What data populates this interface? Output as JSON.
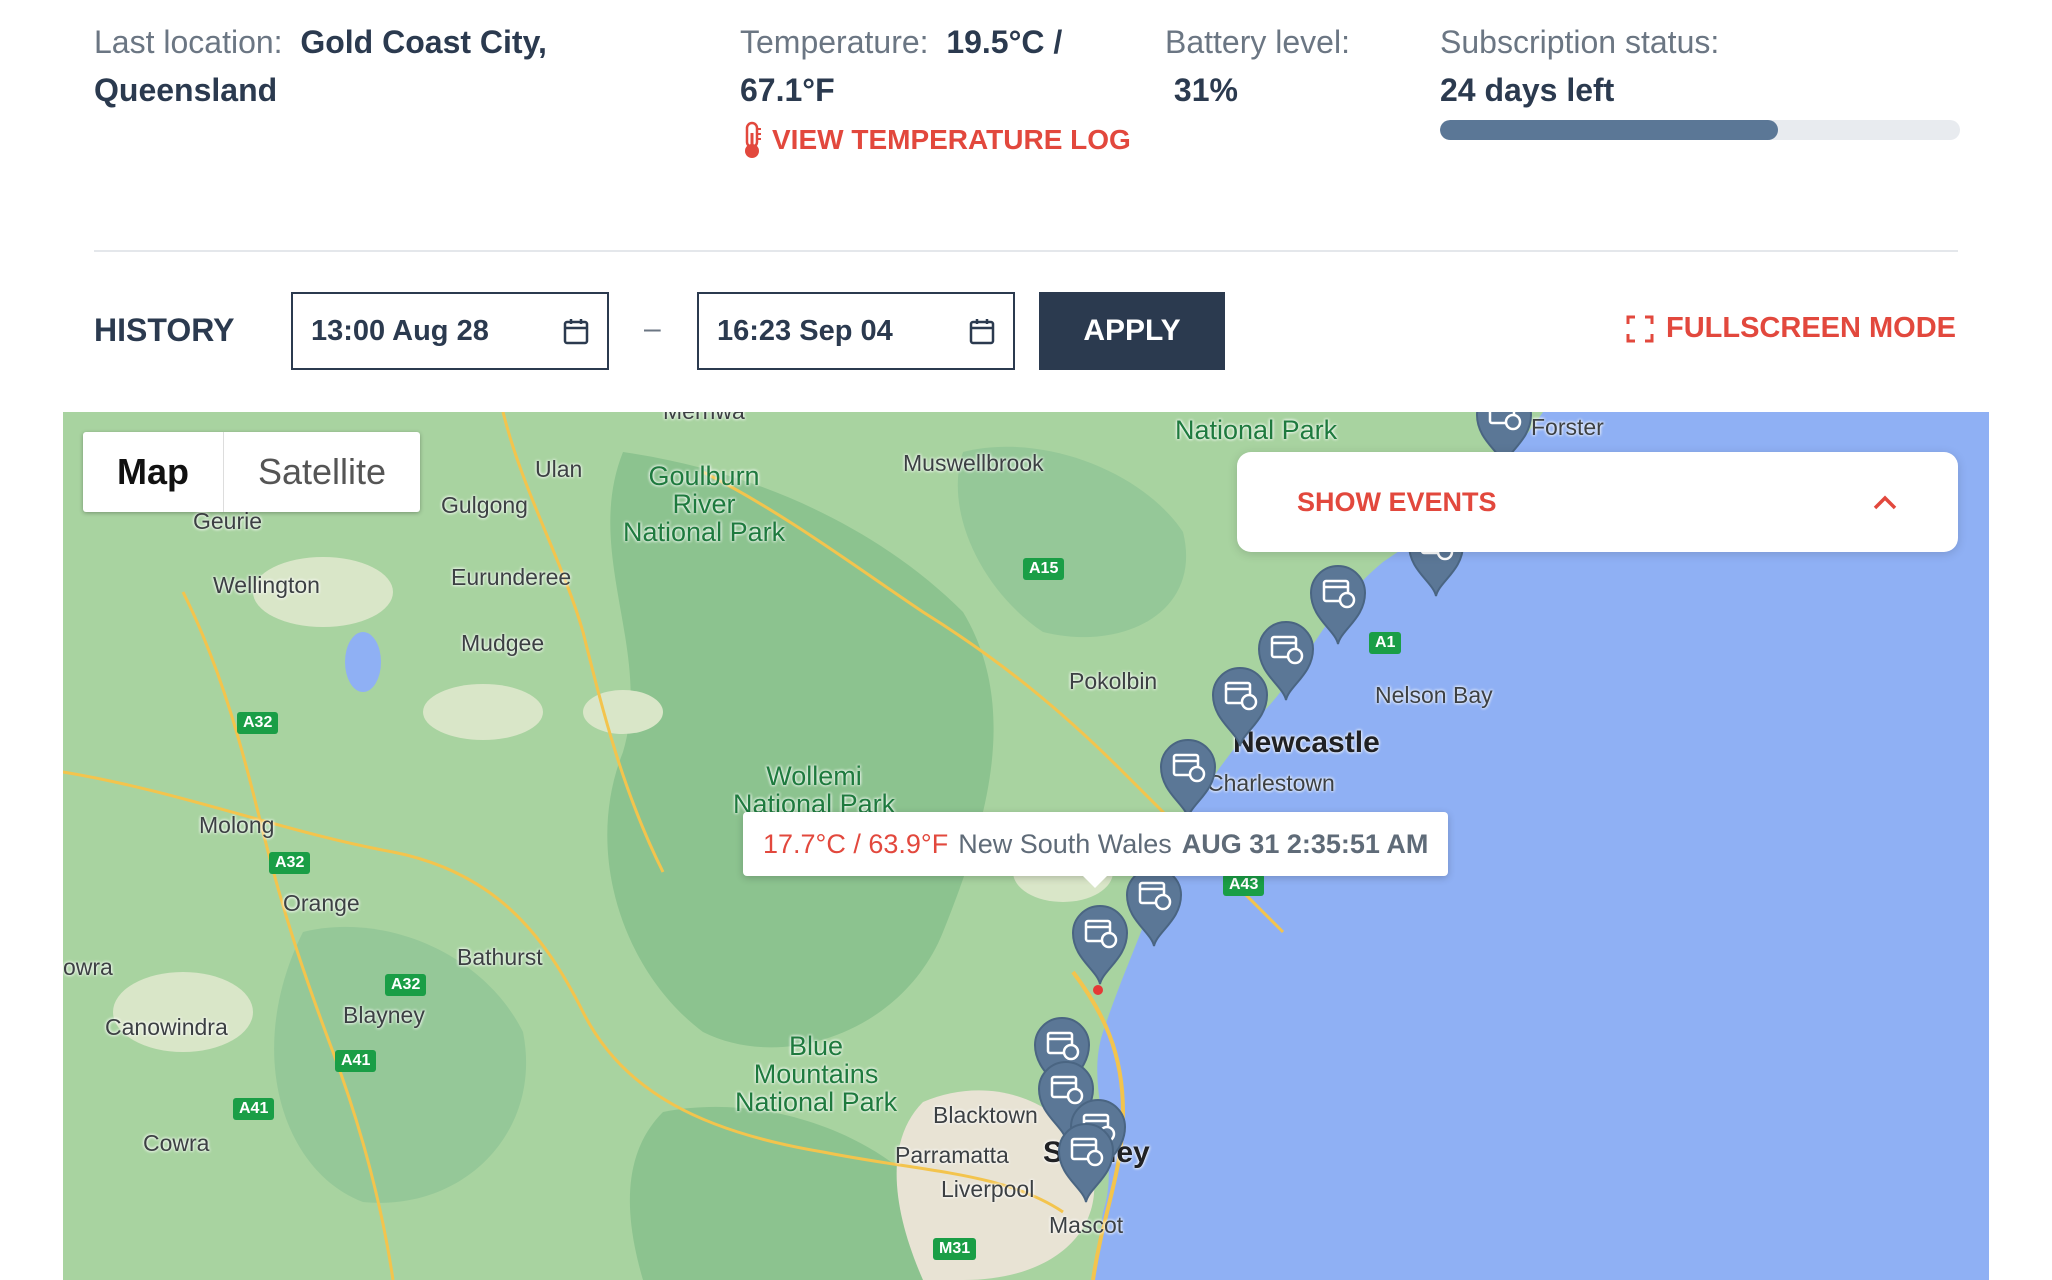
{
  "info": {
    "location_label": "Last location:",
    "location_value": "Gold Coast City, Queensland",
    "temperature_label": "Temperature:",
    "temperature_value": "19.5°C / 67.1°F",
    "temperature_log_link": "VIEW TEMPERATURE LOG",
    "battery_label": "Battery level:",
    "battery_value": "31%",
    "subscription_label": "Subscription status:",
    "subscription_value": "24 days left",
    "subscription_progress": 0.65
  },
  "history": {
    "title": "HISTORY",
    "start": "13:00 Aug 28",
    "separator": "–",
    "end": "16:23 Sep 04",
    "apply_label": "APPLY",
    "fullscreen_label": "FULLSCREEN MODE"
  },
  "map": {
    "type_map": "Map",
    "type_satellite": "Satellite",
    "show_events": "SHOW EVENTS",
    "tooltip": {
      "temperature": "17.7°C / 63.9°F",
      "place": "New South Wales",
      "datetime": "AUG 31 2:35:51 AM"
    },
    "labels": {
      "merriwa": "Merriwa",
      "national_park_top": "National Park",
      "forster": "Forster",
      "muswellbrook": "Muswellbrook",
      "ulan": "Ulan",
      "gulgong": "Gulgong",
      "goulburn_1": "Goulburn",
      "goulburn_2": "River",
      "goulburn_3": "National Park",
      "geurie": "Geurie",
      "wellington": "Wellington",
      "eurundree": "Eurunderee",
      "mudgee": "Mudgee",
      "pokolbin": "Pokolbin",
      "nelson_bay": "Nelson Bay",
      "newcastle": "Newcastle",
      "charlestown": "Charlestown",
      "wollemi_1": "Wollemi",
      "wollemi_2": "National Park",
      "molong": "Molong",
      "orange": "Orange",
      "bathurst": "Bathurst",
      "blayney": "Blayney",
      "owra": "owra",
      "canowindra": "Canowindra",
      "blue_1": "Blue",
      "blue_2": "Mountains",
      "blue_3": "National Park",
      "blacktown": "Blacktown",
      "parramatta": "Parramatta",
      "sydney": "Sydney",
      "liverpool": "Liverpool",
      "mascot": "Mascot",
      "cowra": "Cowra",
      "a15": "A15",
      "a1": "A1",
      "a32_a": "A32",
      "a32_b": "A32",
      "a32_c": "A32",
      "a41_a": "A41",
      "a41_b": "A41",
      "m31": "M31",
      "a43": "A43"
    }
  },
  "colors": {
    "accent_red": "#e2483d",
    "navy": "#2b3a4f",
    "progress_fill": "#5b7796",
    "marker": "#5b7796",
    "ocean": "#8fb0f4",
    "land": "#a8d3a0"
  }
}
